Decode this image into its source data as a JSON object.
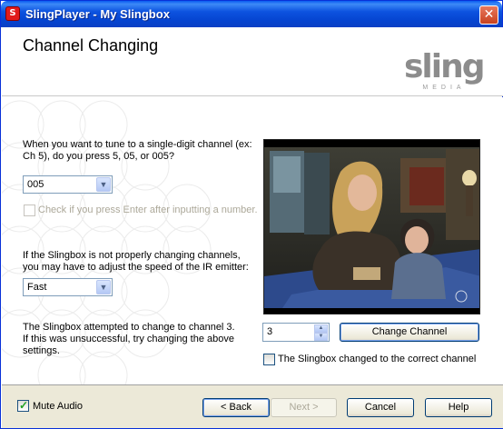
{
  "window": {
    "title": "SlingPlayer - My Slingbox",
    "app_icon": "slingplayer-app-icon",
    "close_glyph": "✕"
  },
  "header": {
    "title": "Channel Changing",
    "logo_word": "sling",
    "logo_sub": "MEDIA"
  },
  "single_digit": {
    "question_line1": "When you want to tune to a single-digit channel (ex:",
    "question_line2": "Ch 5), do you press 5, 05, or 005?",
    "selected": "005",
    "enter_checkbox_label": "Check if you press Enter after inputting a number.",
    "enter_checked": false
  },
  "ir_speed": {
    "hint_line1": "If the Slingbox is not properly changing channels,",
    "hint_line2": "you may have to adjust the speed of the IR emitter:",
    "selected": "Fast"
  },
  "status": {
    "line1": "The Slingbox attempted to change to channel 3.",
    "line2": "If this was unsuccessful, try changing the above",
    "line3": "settings."
  },
  "channel": {
    "value": "3",
    "change_button": "Change Channel",
    "confirm_label": "The Slingbox changed to the correct channel",
    "confirm_checked": false
  },
  "footer": {
    "mute_label": "Mute Audio",
    "mute_checked": true,
    "back": "< Back",
    "next": "Next >",
    "cancel": "Cancel",
    "help": "Help"
  },
  "colors": {
    "titlebar": "#0a5cf0",
    "close": "#c8421f",
    "logo": "#8c8c8c",
    "footer_bg": "#ece9d8",
    "button_border": "#003c74"
  }
}
